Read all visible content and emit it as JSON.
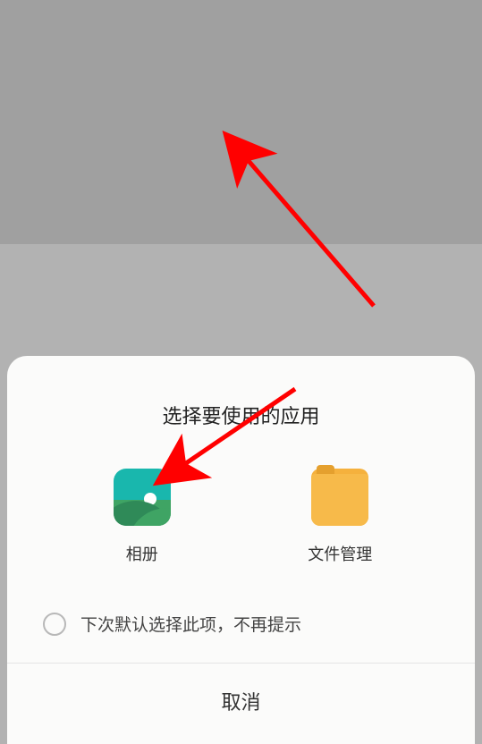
{
  "sheet": {
    "title": "选择要使用的应用",
    "apps": {
      "gallery": {
        "label": "相册"
      },
      "file_manager": {
        "label": "文件管理"
      }
    },
    "default_option": "下次默认选择此项，不再提示",
    "cancel": "取消"
  }
}
